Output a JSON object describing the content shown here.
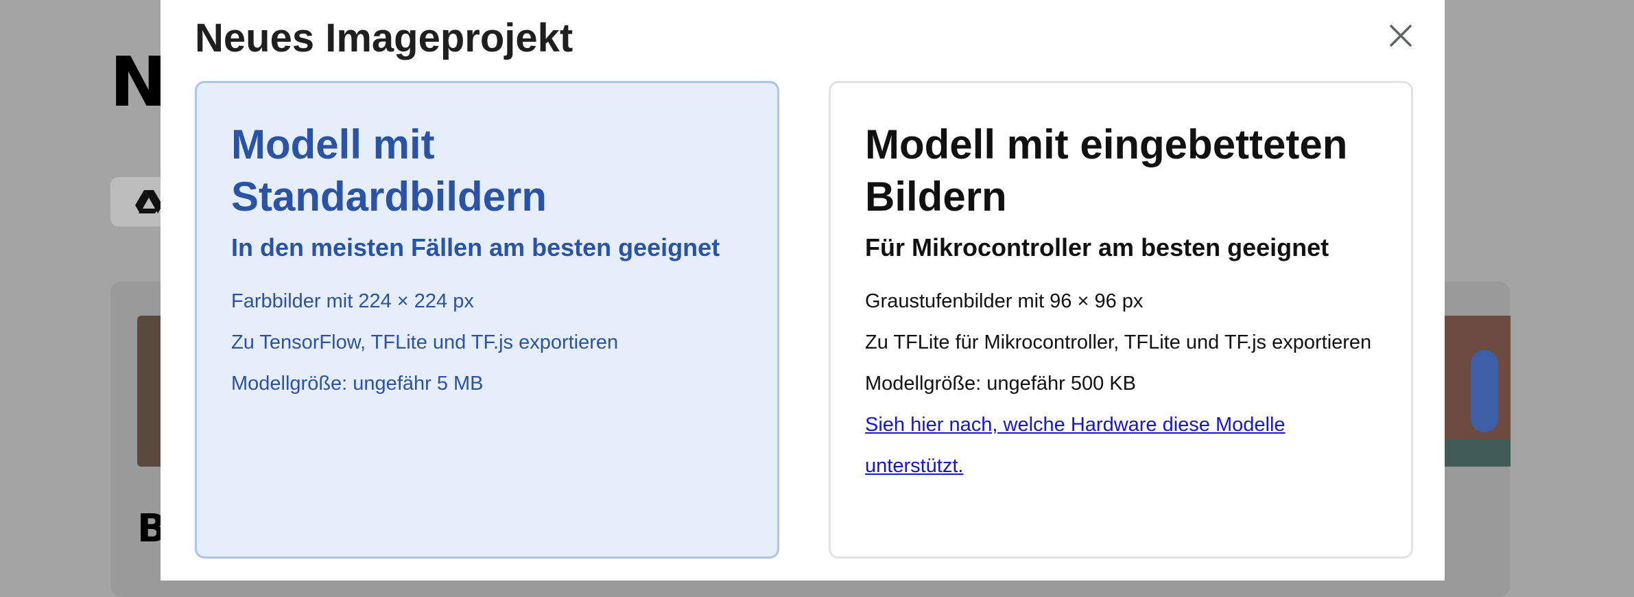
{
  "background": {
    "title_fragment": "N",
    "section_fragment": "B",
    "drive_icon": "google-drive-icon"
  },
  "modal": {
    "title": "Neues Imageprojekt",
    "close_icon": "close-icon",
    "options": [
      {
        "title": "Modell mit Standardbildern",
        "subtitle": "In den meisten Fällen am besten geeignet",
        "features": [
          "Farbbilder mit 224 × 224 px",
          "Zu TensorFlow, TFLite und TF.js exportieren",
          "Modellgröße: ungefähr 5 MB"
        ],
        "selected": true
      },
      {
        "title": "Modell mit eingebetteten Bildern",
        "subtitle": "Für Mikrocontroller am besten geeignet",
        "features": [
          "Graustufenbilder mit 96 × 96 px",
          "Zu TFLite für Mikrocontroller, TFLite und TF.js exportieren",
          "Modellgröße: ungefähr 500 KB"
        ],
        "link": "Sieh hier nach, welche Hardware diese Modelle unterstützt.",
        "selected": false
      }
    ]
  },
  "colors": {
    "selected_bg": "#e6edfb",
    "selected_border": "#aac4ec",
    "selected_text": "#2a53a5",
    "link": "#1515d6",
    "overlay": "#a4a4a4"
  }
}
